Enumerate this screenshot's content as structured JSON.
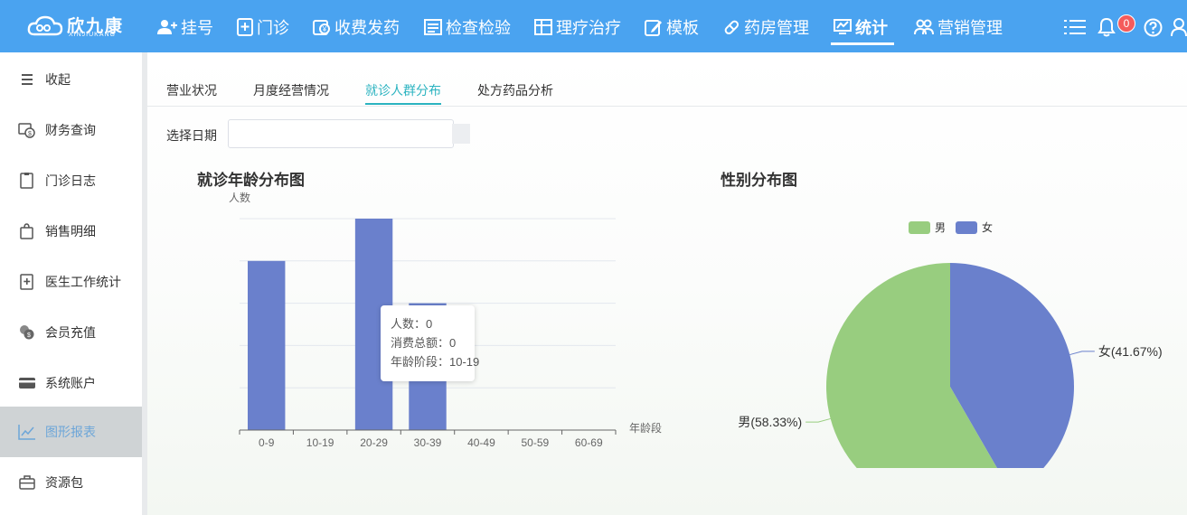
{
  "app": {
    "logo_text": "欣九康",
    "logo_sub": "XINJIUKANG"
  },
  "topnav": [
    {
      "label": "挂号",
      "icon": "user-plus-icon"
    },
    {
      "label": "门诊",
      "icon": "clinic-doc-icon"
    },
    {
      "label": "收费发药",
      "icon": "pay-icon"
    },
    {
      "label": "检查检验",
      "icon": "exam-icon"
    },
    {
      "label": "理疗治疗",
      "icon": "therapy-icon"
    },
    {
      "label": "模板",
      "icon": "edit-icon"
    },
    {
      "label": "药房管理",
      "icon": "pill-icon"
    },
    {
      "label": "统计",
      "icon": "stats-icon",
      "active": true
    },
    {
      "label": "营销管理",
      "icon": "group-icon"
    }
  ],
  "notifications": {
    "count": "0"
  },
  "sidebar": {
    "items": [
      {
        "label": "收起",
        "icon": "collapse-icon"
      },
      {
        "label": "财务查询",
        "icon": "finance-icon"
      },
      {
        "label": "门诊日志",
        "icon": "clipboard-icon"
      },
      {
        "label": "销售明细",
        "icon": "bag-icon"
      },
      {
        "label": "医生工作统计",
        "icon": "doctor-clipboard-icon"
      },
      {
        "label": "会员充值",
        "icon": "coins-icon"
      },
      {
        "label": "系统账户",
        "icon": "card-icon"
      },
      {
        "label": "图形报表",
        "icon": "line-chart-icon",
        "active": true
      },
      {
        "label": "资源包",
        "icon": "briefcase-icon"
      }
    ]
  },
  "tabs": [
    {
      "label": "营业状况"
    },
    {
      "label": "月度经营情况"
    },
    {
      "label": "就诊人群分布",
      "active": true
    },
    {
      "label": "处方药品分析"
    }
  ],
  "filter": {
    "date_label": "选择日期",
    "date_value": ""
  },
  "tooltip": {
    "line1": "人数：0",
    "line2": "消费总额：0",
    "line3": "年龄阶段：10-19"
  },
  "chart_data": [
    {
      "type": "bar",
      "title": "就诊年龄分布图",
      "ylabel": "人数",
      "xlabel": "年龄段",
      "categories": [
        "0-9",
        "10-19",
        "20-29",
        "30-39",
        "40-49",
        "50-59",
        "60-69"
      ],
      "values": [
        4,
        0,
        5,
        3,
        0,
        0,
        0
      ],
      "ylim": [
        0,
        5
      ],
      "color": "#6a80cc",
      "grid": true
    },
    {
      "type": "pie",
      "title": "性别分布图",
      "legend": [
        "男",
        "女"
      ],
      "legend_position": "top",
      "slices": [
        {
          "name": "男",
          "percent": 58.33,
          "label": "男(58.33%)",
          "color": "#98cd7f"
        },
        {
          "name": "女",
          "percent": 41.67,
          "label": "女(41.67%)",
          "color": "#6a80cc"
        }
      ]
    }
  ]
}
